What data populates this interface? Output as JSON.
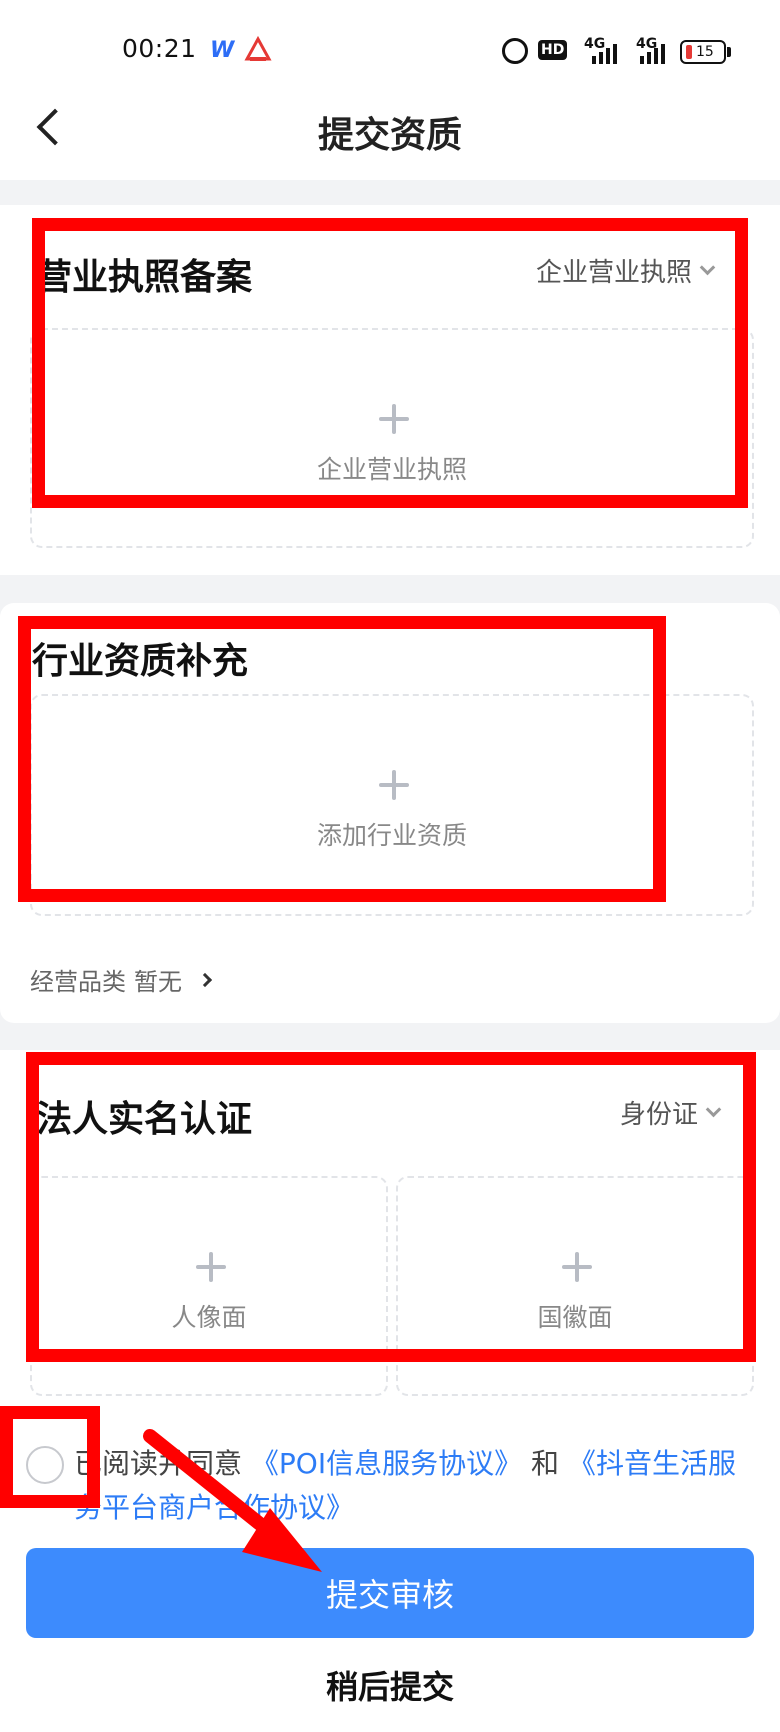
{
  "status_bar": {
    "time": "00:21",
    "app_icon_1": "wps-icon",
    "hd_label": "HD",
    "signal_1": "4G",
    "signal_2": "4G",
    "battery": "15",
    "battery_color": "#e53935"
  },
  "nav": {
    "title": "提交资质"
  },
  "license": {
    "title": "营业执照备案",
    "type_select": "企业营业执照",
    "upload_label": "企业营业执照"
  },
  "industry": {
    "title": "行业资质补充",
    "upload_label": "添加行业资质",
    "category_label": "经营品类",
    "category_value": "暂无"
  },
  "legal": {
    "title": "法人实名认证",
    "type_select": "身份证",
    "upload_front": "人像面",
    "upload_back": "国徽面"
  },
  "agreement": {
    "prefix": "已阅读并同意",
    "link1": "《POI信息服务协议》",
    "conj": "和",
    "link2": "《抖音生活服务平台商户合作协议》"
  },
  "actions": {
    "submit": "提交审核",
    "later": "稍后提交"
  },
  "colors": {
    "accent": "#3d8bfd",
    "link": "#2d7cf6",
    "annotation": "#ff0000"
  }
}
